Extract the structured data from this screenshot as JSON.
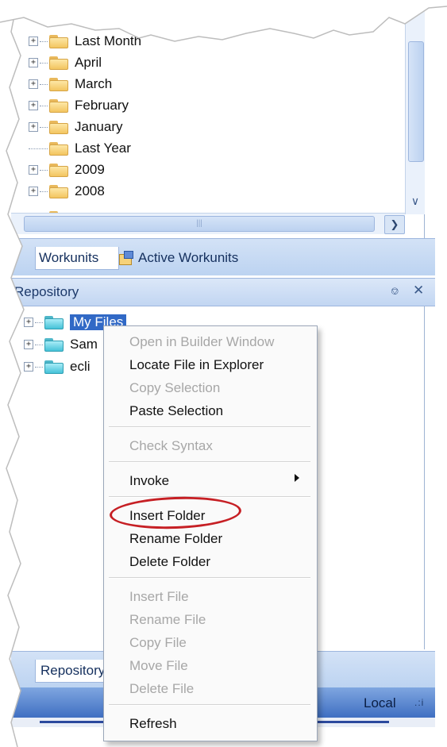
{
  "top_tree": {
    "items": [
      {
        "label": "Last Month",
        "expander": "+"
      },
      {
        "label": "April",
        "expander": "+"
      },
      {
        "label": "March",
        "expander": "+"
      },
      {
        "label": "February",
        "expander": "+"
      },
      {
        "label": "January",
        "expander": "+"
      },
      {
        "label": "Last Year",
        "expander": ""
      },
      {
        "label": "2009",
        "expander": "+"
      },
      {
        "label": "2008",
        "expander": "+"
      }
    ]
  },
  "tabs": {
    "workunits": "Workunits",
    "active_workunits": "Active Workunits"
  },
  "repository": {
    "title": "Repository",
    "items": [
      {
        "label": "My Files",
        "icon": "folder-icon"
      },
      {
        "label": "Sam",
        "icon": "folder-icon"
      },
      {
        "label": "ecli",
        "icon": "folder-icon"
      }
    ]
  },
  "context_menu": {
    "items": [
      {
        "label": "Open in Builder Window",
        "enabled": false
      },
      {
        "label": "Locate File in Explorer",
        "enabled": true
      },
      {
        "label": "Copy Selection",
        "enabled": false
      },
      {
        "label": "Paste Selection",
        "enabled": true
      },
      {
        "label": "Check Syntax",
        "enabled": false
      },
      {
        "label": "Invoke",
        "enabled": true,
        "submenu": true
      },
      {
        "label": "Insert Folder",
        "enabled": true,
        "highlighted": true
      },
      {
        "label": "Rename Folder",
        "enabled": true
      },
      {
        "label": "Delete Folder",
        "enabled": true
      },
      {
        "label": "Insert File",
        "enabled": false
      },
      {
        "label": "Rename File",
        "enabled": false
      },
      {
        "label": "Copy File",
        "enabled": false
      },
      {
        "label": "Move File",
        "enabled": false
      },
      {
        "label": "Delete File",
        "enabled": false
      },
      {
        "label": "Refresh",
        "enabled": true
      }
    ]
  },
  "bottom_tabs": {
    "repository": "Repository"
  },
  "status": {
    "location": "Local"
  },
  "colors": {
    "selection": "#3169c6",
    "highlight_ring": "#c61f24",
    "panel_header": "#c2d6f2",
    "statusbar": "#3f6fc2"
  }
}
